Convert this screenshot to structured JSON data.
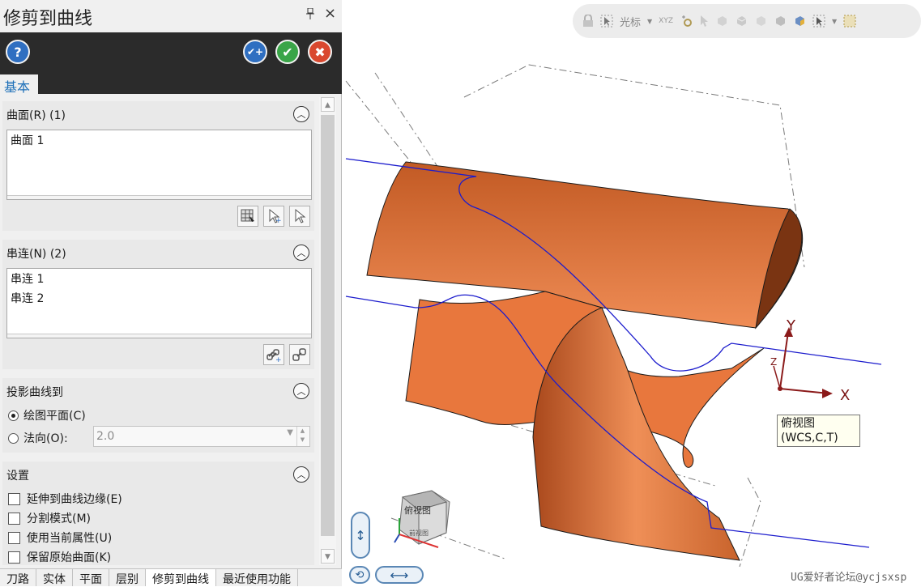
{
  "dialog": {
    "title": "修剪到曲线",
    "pin_glyph": "📌",
    "close_glyph": "×",
    "tab": "基本"
  },
  "header_buttons": {
    "help": "?",
    "apply": "✔+",
    "ok": "✔",
    "cancel": "✖"
  },
  "groups": {
    "surface": {
      "title": "曲面(R) (1)",
      "items": [
        "曲面 1"
      ]
    },
    "chain": {
      "title": "串连(N) (2)",
      "items": [
        "串连 1",
        "串连 2"
      ]
    },
    "projection": {
      "title": "投影曲线到",
      "option_plane": "绘图平面(C)",
      "option_normal": "法向(O):",
      "normal_value": "2.0"
    },
    "settings": {
      "title": "设置",
      "checks": [
        "延伸到曲线边缘(E)",
        "分割模式(M)",
        "使用当前属性(U)",
        "保留原始曲面(K)"
      ]
    }
  },
  "bottom_tabs": [
    "刀路",
    "实体",
    "平面",
    "层别",
    "修剪到曲线",
    "最近使用功能"
  ],
  "toolbar": {
    "cursor_label": "光标"
  },
  "viewport": {
    "tooltip_line1": "俯视图",
    "tooltip_line2": "(WCS,C,T)",
    "axis_x": "X",
    "axis_y": "Y",
    "axis_z": "Z",
    "viewcube_label": "俯视图",
    "viewcube_bottom": "前视图",
    "watermark": "UG爱好者论坛@ycjsxsp"
  },
  "colors": {
    "surface_orange": "#e6773c",
    "curve_blue": "#1c1ccd",
    "axis_red": "#8b1a1a",
    "header_dark": "#2b2b2b",
    "accent_blue": "#1d6fb8"
  }
}
